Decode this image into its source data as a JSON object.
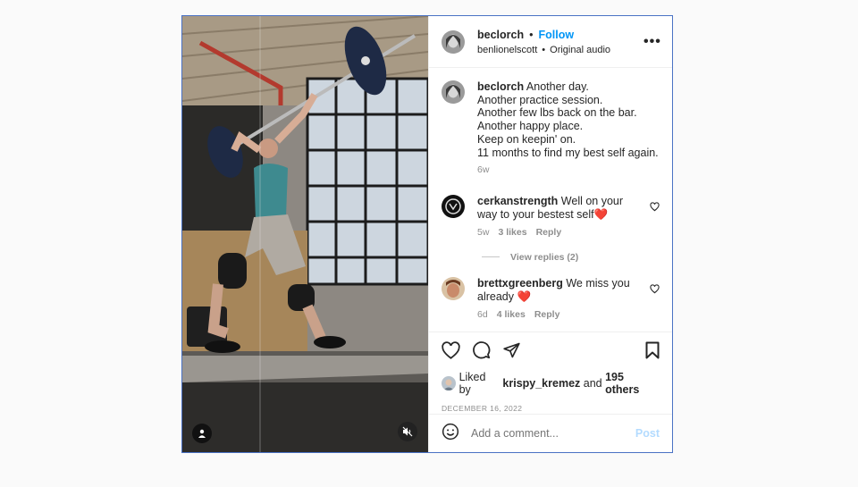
{
  "author": {
    "username": "beclorch",
    "follow_label": "Follow",
    "dot": "•"
  },
  "audio": {
    "artist": "benlionelscott",
    "dot": "•",
    "track": "Original audio"
  },
  "more_label": "•••",
  "caption": {
    "username": "beclorch",
    "text": "Another day.\nAnother practice session.\nAnother few lbs back on the bar.\nAnother happy place.\nKeep on keepin' on.\n11 months to find my best self again.",
    "time": "6w"
  },
  "comments": [
    {
      "username": "cerkanstrength",
      "text": "Well on your way to your bestest self❤️",
      "time": "5w",
      "likes": "3 likes",
      "reply": "Reply"
    },
    {
      "username": "brettxgreenberg",
      "text": "We miss you already ❤️",
      "time": "6d",
      "likes": "4 likes",
      "reply": "Reply"
    }
  ],
  "view_replies": "View replies (2)",
  "likes": {
    "prefix": "Liked by",
    "user": "krispy_kremez",
    "joiner": "and",
    "others": "195 others"
  },
  "date": "DECEMBER 16, 2022",
  "add_comment": {
    "placeholder": "Add a comment...",
    "post_label": "Post"
  },
  "colors": {
    "accent": "#0095f6",
    "border": "#4a72c4",
    "muted": "#8e8e8e",
    "post_disabled": "#b3dbff"
  },
  "icons": [
    "user-tag-icon",
    "mute-icon",
    "more-icon",
    "heart-icon",
    "comment-icon",
    "share-icon",
    "bookmark-icon",
    "emoji-icon"
  ]
}
